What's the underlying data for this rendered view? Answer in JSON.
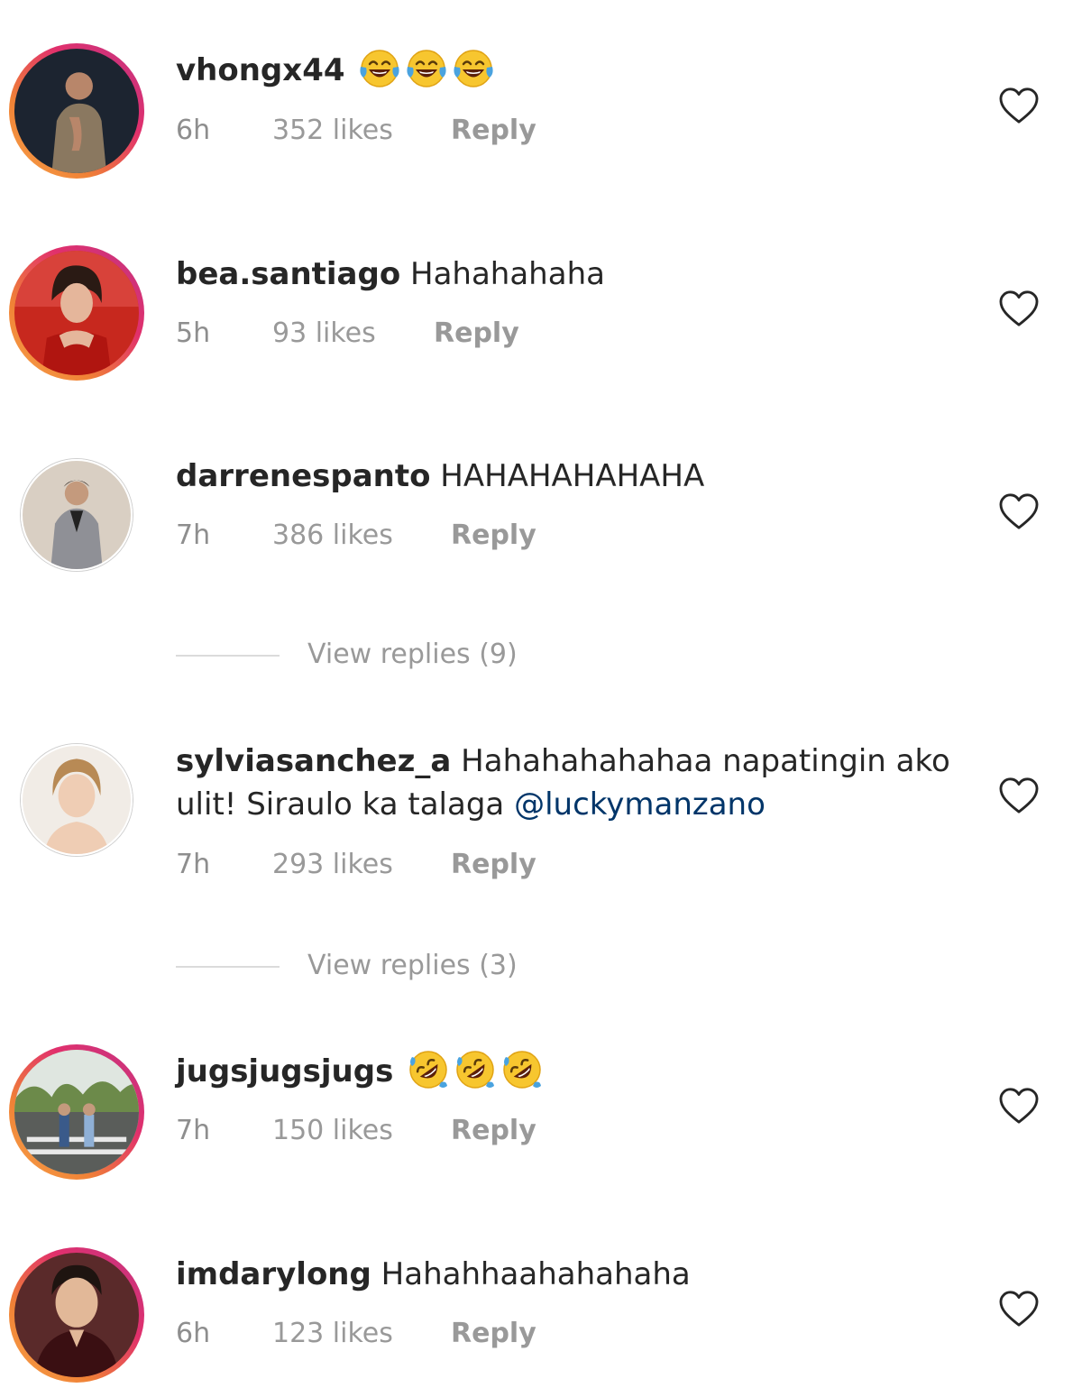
{
  "comments": [
    {
      "username": "vhongx44",
      "text": "",
      "emoji": [
        "face-with-tears-of-joy",
        "face-with-tears-of-joy",
        "face-with-tears-of-joy"
      ],
      "time": "6h",
      "likes": "352 likes",
      "reply": "Reply",
      "story_ring": true
    },
    {
      "username": "bea.santiago",
      "text": "Hahahahaha",
      "time": "5h",
      "likes": "93 likes",
      "reply": "Reply",
      "story_ring": true
    },
    {
      "username": "darrenespanto",
      "text": "HAHAHAHAHAHA",
      "time": "7h",
      "likes": "386 likes",
      "reply": "Reply",
      "story_ring": false,
      "view_replies": "View replies (9)"
    },
    {
      "username": "sylviasanchez_a",
      "text_line1": "Hahahahahahaa napatingin ako",
      "text_line2": "ulit! Siraulo ka talaga",
      "mention": "@luckymanzano",
      "time": "7h",
      "likes": "293 likes",
      "reply": "Reply",
      "story_ring": false,
      "view_replies": "View replies (3)"
    },
    {
      "username": "jugsjugsjugs",
      "text": "",
      "emoji": [
        "rolling-on-floor-laughing",
        "rolling-on-floor-laughing",
        "rolling-on-floor-laughing"
      ],
      "time": "7h",
      "likes": "150 likes",
      "reply": "Reply",
      "story_ring": true
    },
    {
      "username": "imdarylong",
      "text": "Hahahhaahahahaha",
      "time": "6h",
      "likes": "123 likes",
      "reply": "Reply",
      "story_ring": true
    }
  ],
  "colors": {
    "text": "#262626",
    "meta": "#999999",
    "mention": "#003569",
    "story_ring_start": "#f7a24a",
    "story_ring_end": "#c13584"
  },
  "icons": {
    "like": "heart-outline-icon"
  }
}
